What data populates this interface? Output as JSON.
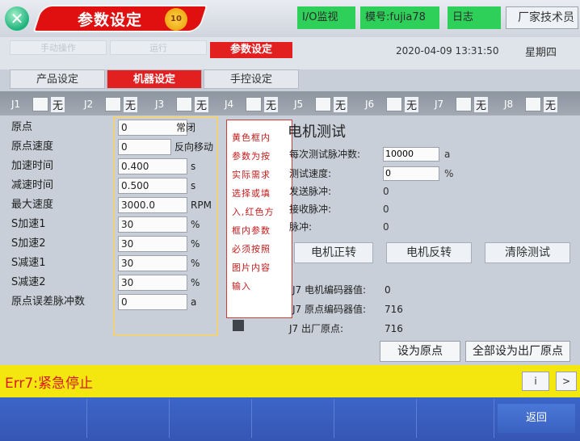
{
  "header": {
    "title": "参数设定",
    "user_level": "10",
    "io_monitor": "I/O监视",
    "model": "模号:fujia78",
    "log": "日志",
    "factory_tech": "厂家技术员"
  },
  "row2": {
    "manual_op": "手动操作",
    "run": "运行",
    "param_tab": "参数设定",
    "date": "2020-04-09 13:31:50",
    "weekday": "星期四"
  },
  "tabs": [
    "产品设定",
    "机器设定",
    "手控设定"
  ],
  "axes": [
    {
      "label": "J1",
      "value": "无"
    },
    {
      "label": "J2",
      "value": "无"
    },
    {
      "label": "J3",
      "value": "无"
    },
    {
      "label": "J4",
      "value": "无"
    },
    {
      "label": "J5",
      "value": "无"
    },
    {
      "label": "J6",
      "value": "无"
    },
    {
      "label": "J7",
      "value": "无"
    },
    {
      "label": "J8",
      "value": "无"
    }
  ],
  "params": [
    {
      "label": "原点",
      "value": "0",
      "unit": "常闭"
    },
    {
      "label": "原点速度",
      "value": "0",
      "unit": "反向移动"
    },
    {
      "label": "加速时间",
      "value": "0.400",
      "unit": "s"
    },
    {
      "label": "减速时间",
      "value": "0.500",
      "unit": "s"
    },
    {
      "label": "最大速度",
      "value": "3000.0",
      "unit": "RPM"
    },
    {
      "label": "S加速1",
      "value": "30",
      "unit": "%"
    },
    {
      "label": "S加速2",
      "value": "30",
      "unit": "%"
    },
    {
      "label": "S减速1",
      "value": "30",
      "unit": "%"
    },
    {
      "label": "S减速2",
      "value": "30",
      "unit": "%"
    },
    {
      "label": "原点误差脉冲数",
      "value": "0",
      "unit": "a"
    }
  ],
  "note": {
    "lines": [
      "黄色框内",
      "参数为按",
      "实际需求",
      "选择或填",
      "入,红色方",
      "框内参数",
      "必须按照",
      "图片内容",
      "输入"
    ]
  },
  "motor_test": {
    "title": "电机测试",
    "pulse_label": "每次测试脉冲数:",
    "pulse_value": "10000",
    "pulse_unit": "a",
    "speed_label": "测试速度:",
    "speed_value": "0",
    "speed_unit": "%",
    "sent_label": "发送脉冲:",
    "sent_value": "0",
    "recv_label": "接收脉冲:",
    "recv_value": "0",
    "pulse_label2": "脉冲:",
    "pulse_value2": "0",
    "btn_forward": "电机正转",
    "btn_reverse": "电机反转",
    "btn_clear": "清除测试"
  },
  "encoder": {
    "enc_label": "J7 电机编码器值:",
    "enc_value": "0",
    "origin_enc_label": "J7 原点编码器值:",
    "origin_enc_value": "716",
    "factory_origin_label": "J7 出厂原点:",
    "factory_origin_value": "716",
    "set_origin_btn": "设为原点",
    "set_all_btn": "全部设为出厂原点"
  },
  "error": {
    "text": "Err7:紧急停止",
    "info_btn": "i",
    "next_btn": ">"
  },
  "footer": {
    "back": "返回"
  }
}
